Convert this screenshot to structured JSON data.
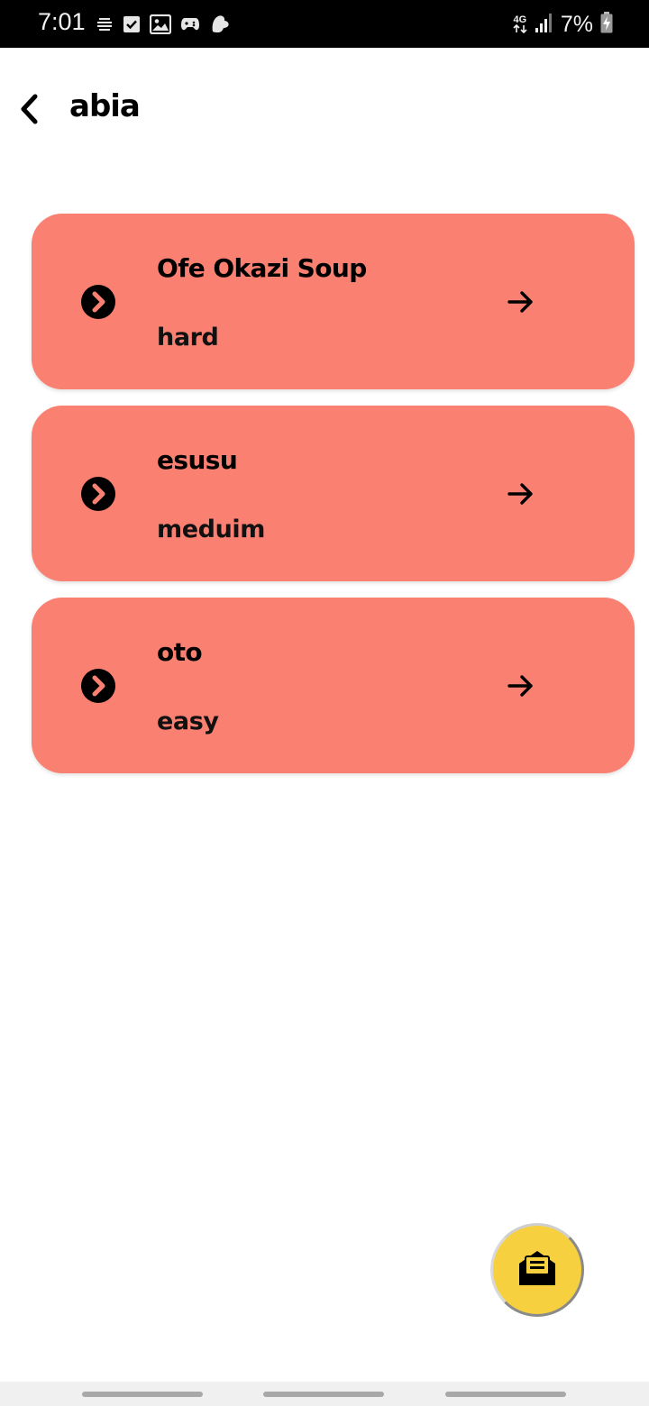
{
  "status_bar": {
    "time": "7:01",
    "network": "4G",
    "battery": "7%"
  },
  "app_bar": {
    "title": "abia"
  },
  "items": [
    {
      "title": "Ofe Okazi Soup",
      "difficulty": "hard"
    },
    {
      "title": "esusu",
      "difficulty": "meduim"
    },
    {
      "title": "oto",
      "difficulty": "easy"
    }
  ],
  "colors": {
    "card_background": "#fa8072",
    "fab_background": "#f7d03f",
    "status_bar": "#000000"
  },
  "icons": {
    "back": "chevron-left-icon",
    "card_leading": "chevron-right-circle-icon",
    "card_trailing": "arrow-right-icon",
    "fab": "open-envelope-letter-icon"
  }
}
